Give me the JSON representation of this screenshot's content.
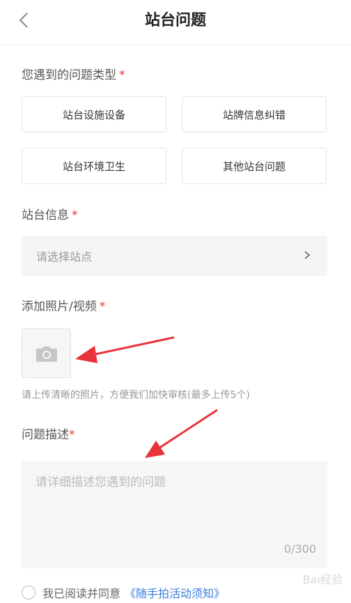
{
  "header": {
    "title": "站台问题"
  },
  "sections": {
    "problem_type": {
      "label": "您遇到的问题类型",
      "required_mark": "*",
      "options": [
        "站台设施设备",
        "站牌信息纠错",
        "站台环境卫生",
        "其他站台问题"
      ]
    },
    "station_info": {
      "label": "站台信息",
      "required_mark": "*",
      "placeholder": "请选择站点"
    },
    "media": {
      "label": "添加照片/视频",
      "required_mark": "*",
      "hint": "请上传清晰的照片，方便我们加快审核(最多上传5个)"
    },
    "description": {
      "label": "问题描述",
      "required_mark": "*",
      "placeholder": "请详细描述您遇到的问题",
      "counter": "0/300"
    },
    "agreement": {
      "text": "我已阅读并同意",
      "link": "《随手拍活动须知》"
    }
  },
  "watermark": "Bai经验",
  "colors": {
    "required": "#e8332f",
    "link": "#3b7ddb",
    "arrow": "#e8333a"
  },
  "icons": {
    "back": "chevron-left-icon",
    "select_chevron": "chevron-right-icon",
    "upload": "camera-icon",
    "agree": "radio-circle-icon"
  }
}
